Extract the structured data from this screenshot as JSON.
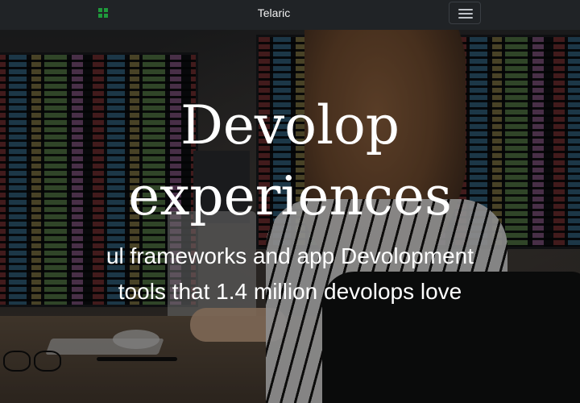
{
  "navbar": {
    "brand": "Telaric",
    "logo_icon": "grid-logo-icon",
    "menu_icon": "hamburger-menu-icon",
    "logo_color": "#1f9a3b"
  },
  "hero": {
    "headline_line1": "Devolop",
    "headline_line2": "experiences",
    "subline_line1": "ul frameworks and app Devolopment",
    "subline_line2": "tools that 1.4 million devolops love"
  }
}
